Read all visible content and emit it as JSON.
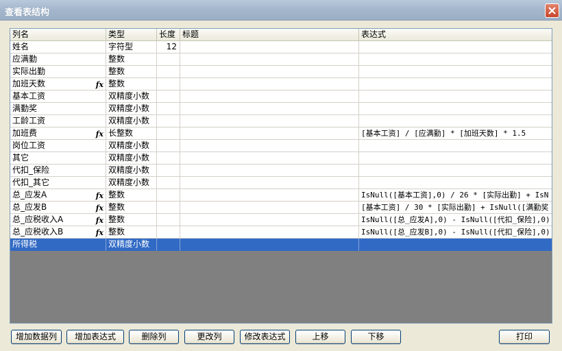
{
  "window": {
    "title": "查看表结构"
  },
  "columns": [
    "列名",
    "类型",
    "长度",
    "标题",
    "表达式"
  ],
  "rows": [
    {
      "name": "姓名",
      "fx": false,
      "type": "字符型",
      "length": "12",
      "caption": "",
      "expr": ""
    },
    {
      "name": "应满勤",
      "fx": false,
      "type": "整数",
      "length": "",
      "caption": "",
      "expr": ""
    },
    {
      "name": "实际出勤",
      "fx": false,
      "type": "整数",
      "length": "",
      "caption": "",
      "expr": ""
    },
    {
      "name": "加班天数",
      "fx": true,
      "type": "整数",
      "length": "",
      "caption": "",
      "expr": ""
    },
    {
      "name": "基本工资",
      "fx": false,
      "type": "双精度小数",
      "length": "",
      "caption": "",
      "expr": ""
    },
    {
      "name": "满勤奖",
      "fx": false,
      "type": "双精度小数",
      "length": "",
      "caption": "",
      "expr": ""
    },
    {
      "name": "工龄工资",
      "fx": false,
      "type": "双精度小数",
      "length": "",
      "caption": "",
      "expr": ""
    },
    {
      "name": "加班费",
      "fx": true,
      "type": "长整数",
      "length": "",
      "caption": "",
      "expr": "[基本工资] / [应满勤] * [加班天数] * 1.5"
    },
    {
      "name": "岗位工资",
      "fx": false,
      "type": "双精度小数",
      "length": "",
      "caption": "",
      "expr": ""
    },
    {
      "name": "其它",
      "fx": false,
      "type": "双精度小数",
      "length": "",
      "caption": "",
      "expr": ""
    },
    {
      "name": "代扣_保险",
      "fx": false,
      "type": "双精度小数",
      "length": "",
      "caption": "",
      "expr": ""
    },
    {
      "name": "代扣_其它",
      "fx": false,
      "type": "双精度小数",
      "length": "",
      "caption": "",
      "expr": ""
    },
    {
      "name": "总_应发A",
      "fx": true,
      "type": "整数",
      "length": "",
      "caption": "",
      "expr": "IsNull([基本工资],0) / 26 * [实际出勤] +  IsN"
    },
    {
      "name": "总_应发B",
      "fx": true,
      "type": "整数",
      "length": "",
      "caption": "",
      "expr": "[基本工资] / 30 * [实际出勤] + IsNull([满勤奖"
    },
    {
      "name": "总_应税收入A",
      "fx": true,
      "type": "整数",
      "length": "",
      "caption": "",
      "expr": "IsNull([总_应发A],0) - IsNull([代扣_保险],0)"
    },
    {
      "name": "总_应税收入B",
      "fx": true,
      "type": "整数",
      "length": "",
      "caption": "",
      "expr": "IsNull([总_应发B],0) - IsNull([代扣_保险],0)"
    },
    {
      "name": "所得税",
      "fx": false,
      "type": "双精度小数",
      "length": "",
      "caption": "",
      "expr": "",
      "selected": true
    }
  ],
  "fx_label": "fx",
  "buttons": {
    "add_data_column": "增加数据列",
    "add_expression": "增加表达式",
    "delete_column": "删除列",
    "change_column": "更改列",
    "edit_expression": "修改表达式",
    "move_up": "上移",
    "move_down": "下移",
    "print": "打印"
  },
  "colors": {
    "selection": "#316ac5",
    "grid_background": "#808080",
    "dialog": "#ece9d8"
  }
}
